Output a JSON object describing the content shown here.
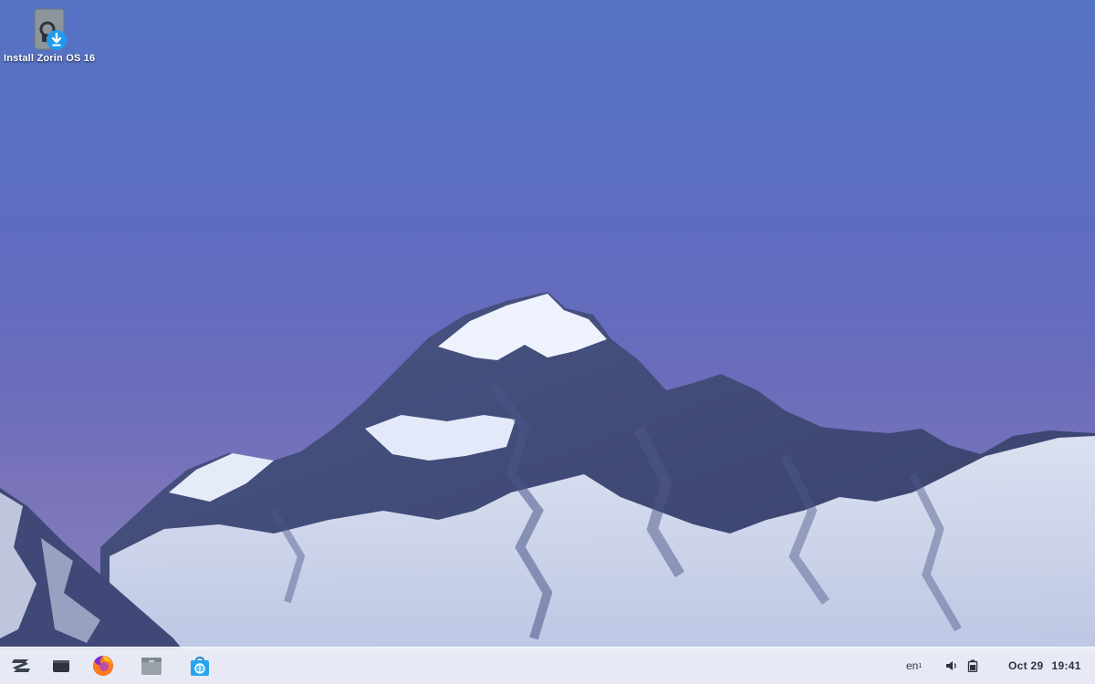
{
  "desktop": {
    "icons": [
      {
        "label": "Install Zorin OS 16",
        "icon": "drive-download-icon"
      }
    ]
  },
  "taskbar": {
    "launchers": [
      {
        "name": "zorin-menu-button",
        "icon": "zorin-logo-icon"
      },
      {
        "name": "show-desktop-button",
        "icon": "window-icon"
      },
      {
        "name": "firefox-button",
        "icon": "firefox-icon"
      },
      {
        "name": "files-button",
        "icon": "folder-icon"
      },
      {
        "name": "software-store-button",
        "icon": "store-bag-icon"
      }
    ],
    "tray": {
      "keyboard_layout": "en",
      "keyboard_layout_sub": "1",
      "volume_icon": "speaker-icon",
      "battery_icon": "battery-icon",
      "date": "Oct 29",
      "time": "19:41"
    }
  },
  "colors": {
    "sky_top": "#5573c4",
    "sky_bottom": "#8a86c0",
    "taskbar_bg": "#eef2f7",
    "download_badge": "#1e9bef",
    "firefox_orange": "#ff7a1a",
    "store_blue": "#27a4ee"
  }
}
